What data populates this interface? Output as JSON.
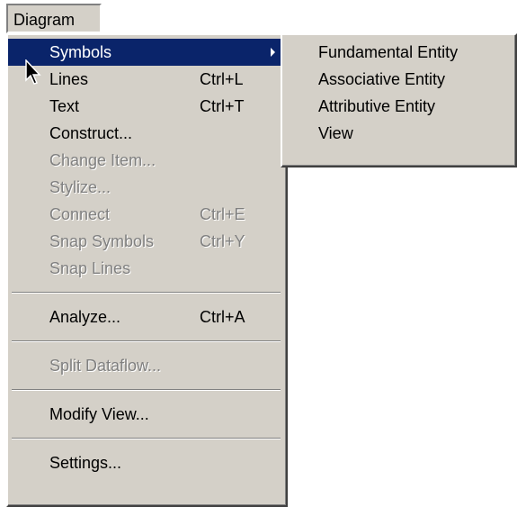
{
  "menubar": {
    "diagram_label": "Diagram"
  },
  "main_menu": {
    "symbols": "Symbols",
    "lines": "Lines",
    "lines_shortcut": "Ctrl+L",
    "text": "Text",
    "text_shortcut": "Ctrl+T",
    "construct": "Construct...",
    "change_item": "Change Item...",
    "stylize": "Stylize...",
    "connect": "Connect",
    "connect_shortcut": "Ctrl+E",
    "snap_symbols": "Snap Symbols",
    "snap_symbols_shortcut": "Ctrl+Y",
    "snap_lines": "Snap Lines",
    "analyze": "Analyze...",
    "analyze_shortcut": "Ctrl+A",
    "split_dataflow": "Split Dataflow...",
    "modify_view": "Modify View...",
    "settings": "Settings..."
  },
  "sub_menu": {
    "fundamental_entity": "Fundamental Entity",
    "associative_entity": "Associative Entity",
    "attributive_entity": "Attributive Entity",
    "view": "View"
  },
  "colors": {
    "menu_bg": "#d4d0c8",
    "highlight": "#0a246a",
    "disabled_text": "#808080"
  }
}
